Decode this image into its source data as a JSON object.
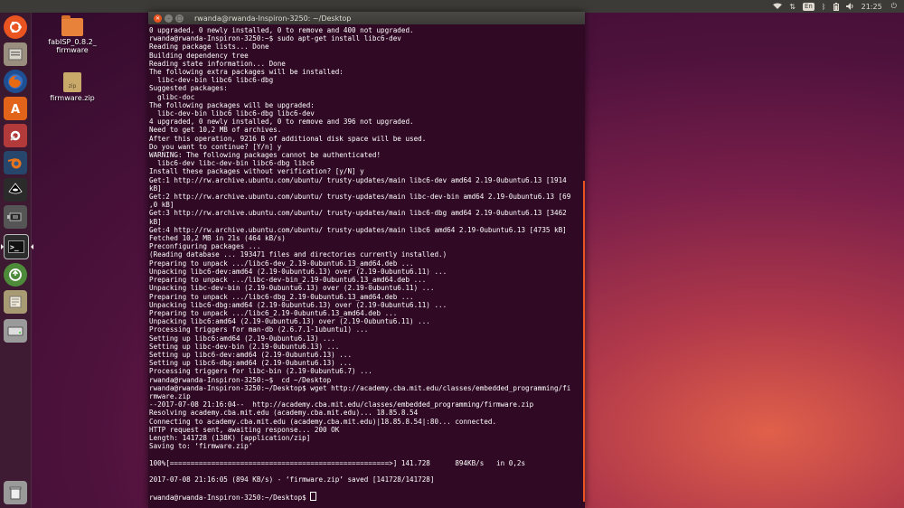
{
  "topbar": {
    "keyboard_layout": "En",
    "clock": "21:25",
    "icons": [
      "wifi-icon",
      "sort-icon",
      "keyboard-icon",
      "bluetooth-icon",
      "battery-icon",
      "volume-icon",
      "power-icon"
    ]
  },
  "launcher": {
    "items": [
      {
        "name": "ubuntu-dash-icon",
        "glyph": "◉",
        "color": "#e95420"
      },
      {
        "name": "files-icon",
        "glyph": "▤",
        "color": "#9a8f7e"
      },
      {
        "name": "firefox-icon",
        "glyph": "◐",
        "color": "#e66a12"
      },
      {
        "name": "software-center-icon",
        "glyph": "A",
        "color": "#e2641a"
      },
      {
        "name": "settings-icon",
        "glyph": "⚙",
        "color": "#b23a3a"
      },
      {
        "name": "blender-icon",
        "glyph": "◎",
        "color": "#e8741c"
      },
      {
        "name": "inkscape-icon",
        "glyph": "✒",
        "color": "#333333"
      },
      {
        "name": "avr-programmer-icon",
        "glyph": "⚡",
        "color": "#555555"
      },
      {
        "name": "terminal-icon",
        "glyph": ">_",
        "color": "#2c2c2c"
      },
      {
        "name": "software-updater-icon",
        "glyph": "↻",
        "color": "#4d8a3a"
      },
      {
        "name": "text-editor-icon",
        "glyph": "✎",
        "color": "#a89a72"
      },
      {
        "name": "drive-icon",
        "glyph": "▭",
        "color": "#9a9a9a"
      },
      {
        "name": "trash-icon",
        "glyph": "🗑",
        "color": "#9a9a9a"
      }
    ]
  },
  "desktop": {
    "icons": [
      {
        "label_line1": "fabISP_0.8.2_",
        "label_line2": "firmware",
        "type": "folder"
      },
      {
        "label_line1": "firmware.zip",
        "label_line2": "",
        "type": "zip"
      }
    ]
  },
  "terminal": {
    "title": "rwanda@rwanda-Inspiron-3250: ~/Desktop",
    "lines": [
      "0 upgraded, 0 newly installed, 0 to remove and 400 not upgraded.",
      "rwanda@rwanda-Inspiron-3250:~$ sudo apt-get install libc6-dev",
      "Reading package lists... Done",
      "Building dependency tree",
      "Reading state information... Done",
      "The following extra packages will be installed:",
      "  libc-dev-bin libc6 libc6-dbg",
      "Suggested packages:",
      "  glibc-doc",
      "The following packages will be upgraded:",
      "  libc-dev-bin libc6 libc6-dbg libc6-dev",
      "4 upgraded, 0 newly installed, 0 to remove and 396 not upgraded.",
      "Need to get 10,2 MB of archives.",
      "After this operation, 9216 B of additional disk space will be used.",
      "Do you want to continue? [Y/n] y",
      "WARNING: The following packages cannot be authenticated!",
      "  libc6-dev libc-dev-bin libc6-dbg libc6",
      "Install these packages without verification? [y/N] y",
      "Get:1 http://rw.archive.ubuntu.com/ubuntu/ trusty-updates/main libc6-dev amd64 2.19-0ubuntu6.13 [1914",
      "kB]",
      "Get:2 http://rw.archive.ubuntu.com/ubuntu/ trusty-updates/main libc-dev-bin amd64 2.19-0ubuntu6.13 [69",
      ",0 kB]",
      "Get:3 http://rw.archive.ubuntu.com/ubuntu/ trusty-updates/main libc6-dbg amd64 2.19-0ubuntu6.13 [3462",
      "kB]",
      "Get:4 http://rw.archive.ubuntu.com/ubuntu/ trusty-updates/main libc6 amd64 2.19-0ubuntu6.13 [4735 kB]",
      "Fetched 10,2 MB in 21s (464 kB/s)",
      "Preconfiguring packages ...",
      "(Reading database ... 193471 files and directories currently installed.)",
      "Preparing to unpack .../libc6-dev_2.19-0ubuntu6.13_amd64.deb ...",
      "Unpacking libc6-dev:amd64 (2.19-0ubuntu6.13) over (2.19-0ubuntu6.11) ...",
      "Preparing to unpack .../libc-dev-bin_2.19-0ubuntu6.13_amd64.deb ...",
      "Unpacking libc-dev-bin (2.19-0ubuntu6.13) over (2.19-0ubuntu6.11) ...",
      "Preparing to unpack .../libc6-dbg_2.19-0ubuntu6.13_amd64.deb ...",
      "Unpacking libc6-dbg:amd64 (2.19-0ubuntu6.13) over (2.19-0ubuntu6.11) ...",
      "Preparing to unpack .../libc6_2.19-0ubuntu6.13_amd64.deb ...",
      "Unpacking libc6:amd64 (2.19-0ubuntu6.13) over (2.19-0ubuntu6.11) ...",
      "Processing triggers for man-db (2.6.7.1-1ubuntu1) ...",
      "Setting up libc6:amd64 (2.19-0ubuntu6.13) ...",
      "Setting up libc-dev-bin (2.19-0ubuntu6.13) ...",
      "Setting up libc6-dev:amd64 (2.19-0ubuntu6.13) ...",
      "Setting up libc6-dbg:amd64 (2.19-0ubuntu6.13) ...",
      "Processing triggers for libc-bin (2.19-0ubuntu6.7) ...",
      "rwanda@rwanda-Inspiron-3250:~$  cd ~/Desktop",
      "rwanda@rwanda-Inspiron-3250:~/Desktop$ wget http://academy.cba.mit.edu/classes/embedded_programming/fi",
      "rmware.zip",
      "--2017-07-08 21:16:04--  http://academy.cba.mit.edu/classes/embedded_programming/firmware.zip",
      "Resolving academy.cba.mit.edu (academy.cba.mit.edu)... 18.85.8.54",
      "Connecting to academy.cba.mit.edu (academy.cba.mit.edu)|18.85.8.54|:80... connected.",
      "HTTP request sent, awaiting response... 200 OK",
      "Length: 141728 (138K) [application/zip]",
      "Saving to: ‘firmware.zip’",
      "",
      "100%[=====================================================>] 141.728      894KB/s   in 0,2s",
      "",
      "2017-07-08 21:16:05 (894 KB/s) - ‘firmware.zip’ saved [141728/141728]",
      "",
      "rwanda@rwanda-Inspiron-3250:~/Desktop$ "
    ]
  }
}
